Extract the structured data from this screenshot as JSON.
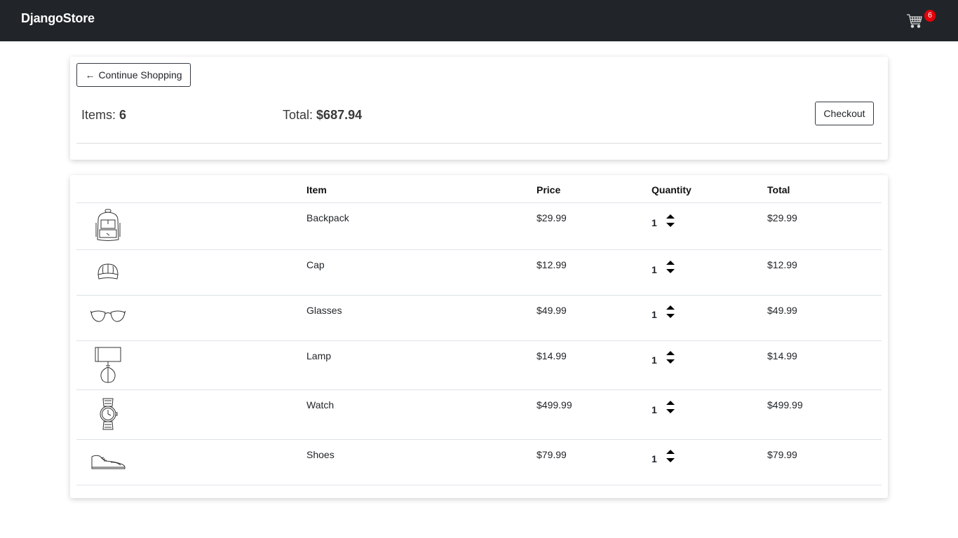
{
  "nav": {
    "brand": "DjangoStore",
    "cart_count": "6",
    "cart_icon": "shopping-cart-icon"
  },
  "summary": {
    "continue_label": "Continue Shopping",
    "continue_arrow": "←",
    "items_label": "Items:",
    "items_value": "6",
    "total_label": "Total:",
    "total_value": "$687.94",
    "checkout_label": "Checkout"
  },
  "table": {
    "headers": {
      "item": "Item",
      "price": "Price",
      "quantity": "Quantity",
      "total": "Total"
    },
    "rows": [
      {
        "name": "Backpack",
        "price": "$29.99",
        "quantity": "1",
        "total": "$29.99",
        "icon": "backpack-icon"
      },
      {
        "name": "Cap",
        "price": "$12.99",
        "quantity": "1",
        "total": "$12.99",
        "icon": "cap-icon"
      },
      {
        "name": "Glasses",
        "price": "$49.99",
        "quantity": "1",
        "total": "$49.99",
        "icon": "glasses-icon"
      },
      {
        "name": "Lamp",
        "price": "$14.99",
        "quantity": "1",
        "total": "$14.99",
        "icon": "lamp-icon"
      },
      {
        "name": "Watch",
        "price": "$499.99",
        "quantity": "1",
        "total": "$499.99",
        "icon": "watch-icon"
      },
      {
        "name": "Shoes",
        "price": "$79.99",
        "quantity": "1",
        "total": "$79.99",
        "icon": "shoes-icon"
      }
    ]
  }
}
